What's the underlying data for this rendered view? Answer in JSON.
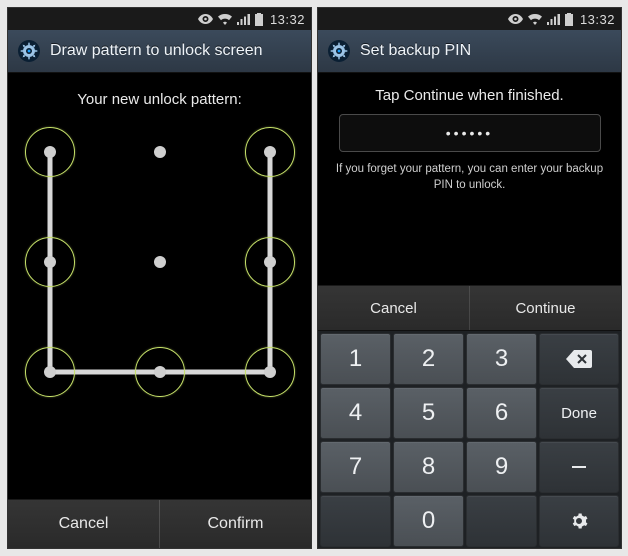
{
  "status": {
    "time": "13:32"
  },
  "left": {
    "title": "Draw pattern to unlock screen",
    "prompt": "Your new unlock pattern:",
    "grid": {
      "positions": [
        20,
        130,
        240
      ],
      "active_indices": [
        0,
        2,
        3,
        5,
        6,
        7,
        8
      ],
      "path_order": [
        0,
        3,
        6,
        7,
        8,
        5,
        2
      ]
    },
    "buttons": {
      "cancel": "Cancel",
      "confirm": "Confirm"
    }
  },
  "right": {
    "title": "Set backup PIN",
    "hint": "Tap Continue when finished.",
    "pin_mask": "••••••",
    "fineprint": "If you forget your pattern, you can enter your backup PIN to unlock.",
    "buttons": {
      "cancel": "Cancel",
      "continue": "Continue"
    },
    "keypad": {
      "k1": "1",
      "k2": "2",
      "k3": "3",
      "k4": "4",
      "k5": "5",
      "k6": "6",
      "k7": "7",
      "k8": "8",
      "k9": "9",
      "k0": "0",
      "done": "Done"
    }
  }
}
